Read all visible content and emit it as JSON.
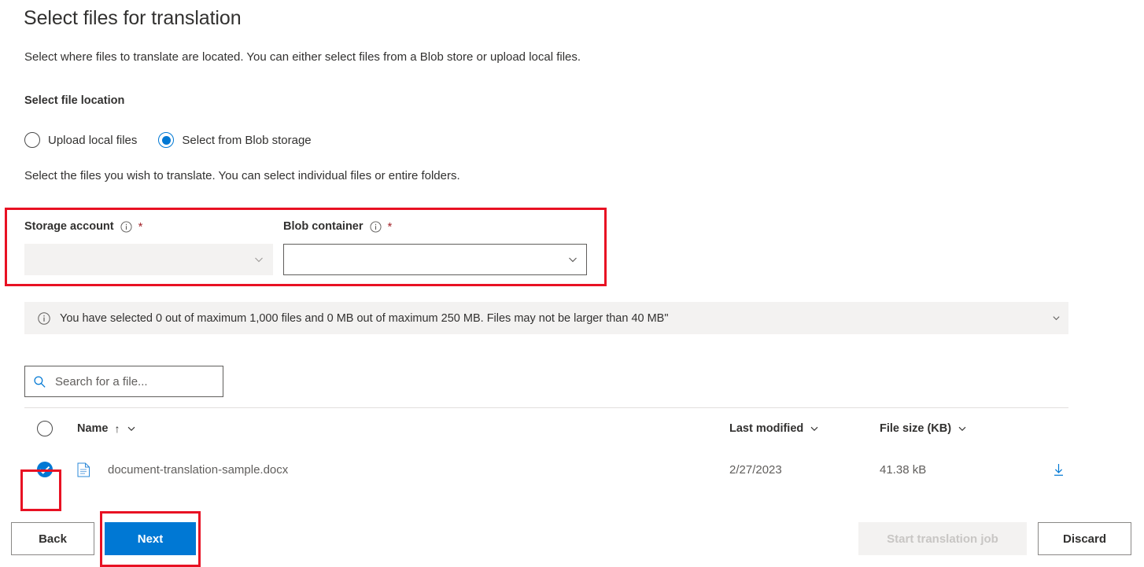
{
  "header": {
    "title": "Select files for translation",
    "subtitle": "Select where files to translate are located. You can either select files from a Blob store or upload local files."
  },
  "file_location": {
    "section_label": "Select file location",
    "options": [
      {
        "label": "Upload local files",
        "selected": false
      },
      {
        "label": "Select from Blob storage",
        "selected": true
      }
    ],
    "helper_text": "Select the files you wish to translate. You can select individual files or entire folders."
  },
  "form": {
    "storage_account": {
      "label": "Storage account",
      "required_marker": "*",
      "value": "",
      "disabled": true,
      "info_icon": "info-icon",
      "chevron_icon": "chevron-down-icon"
    },
    "blob_container": {
      "label": "Blob container",
      "required_marker": "*",
      "value": "",
      "disabled": false,
      "info_icon": "info-icon",
      "chevron_icon": "chevron-down-icon"
    }
  },
  "message_bar": {
    "icon": "info-icon",
    "text": "You have selected 0 out of maximum 1,000 files and 0 MB out of maximum 250 MB. Files may not be larger than 40 MB\"",
    "expand_icon": "chevron-down-icon"
  },
  "search": {
    "icon": "search-icon",
    "placeholder": "Search for a file...",
    "value": ""
  },
  "table": {
    "columns": [
      {
        "key": "select",
        "label": "",
        "icon": "circle-checkbox-icon"
      },
      {
        "key": "name",
        "label": "Name",
        "sort_indicator": "↑",
        "menu_icon": "chevron-down-icon"
      },
      {
        "key": "modified",
        "label": "Last modified",
        "menu_icon": "chevron-down-icon"
      },
      {
        "key": "size",
        "label": "File size (KB)",
        "menu_icon": "chevron-down-icon"
      }
    ],
    "select_all_checked": false,
    "rows": [
      {
        "selected": true,
        "file_icon": "document-icon",
        "name": "document-translation-sample.docx",
        "last_modified": "2/27/2023",
        "file_size": "41.38 kB",
        "action_icon": "download-icon"
      }
    ]
  },
  "footer": {
    "back_label": "Back",
    "next_label": "Next",
    "start_label": "Start translation job",
    "discard_label": "Discard",
    "start_disabled": true
  },
  "colors": {
    "accent": "#0078d4",
    "annotation": "#e81123",
    "required": "#a4262c",
    "text": "#323130",
    "muted_text": "#605e5c",
    "surface_muted": "#f3f2f1"
  }
}
